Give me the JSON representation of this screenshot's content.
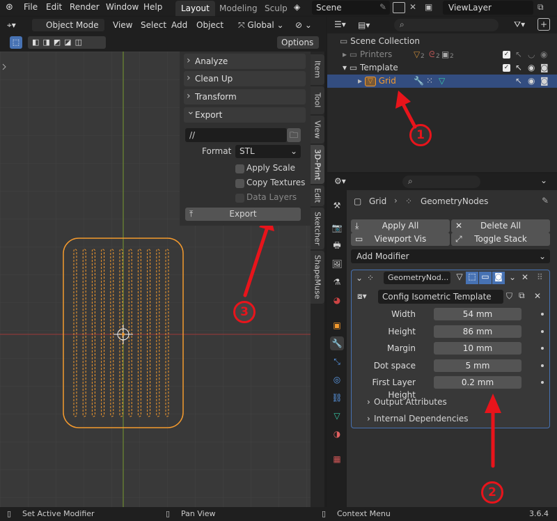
{
  "topbar": {
    "menu": [
      "File",
      "Edit",
      "Render",
      "Window",
      "Help"
    ],
    "workspaces": [
      "Layout",
      "Modeling",
      "Sculp"
    ],
    "scene": "Scene",
    "view_layer": "ViewLayer"
  },
  "viewport_header": {
    "mode": "Object Mode",
    "menus": [
      "View",
      "Select",
      "Add",
      "Object"
    ],
    "orientation": "Global",
    "options": "Options"
  },
  "npanel": {
    "sections": [
      "Analyze",
      "Clean Up",
      "Transform",
      "Export"
    ],
    "export_path": "//",
    "format_label": "Format",
    "format_value": "STL",
    "checkboxes": [
      "Apply Scale",
      "Copy Textures",
      "Data Layers"
    ],
    "export_button": "Export",
    "tabs": [
      "Item",
      "Tool",
      "View",
      "3D-Print",
      "Edit",
      "Sketcher",
      "ShapeMuse"
    ]
  },
  "outliner": {
    "root": "Scene Collection",
    "rows": [
      {
        "label": "Printers",
        "counts": [
          "2",
          "2",
          "2"
        ]
      },
      {
        "label": "Template"
      },
      {
        "label": "Grid"
      }
    ]
  },
  "properties": {
    "breadcrumb_object": "Grid",
    "breadcrumb_modifier": "GeometryNodes",
    "buttons": {
      "apply_all": "Apply All",
      "delete_all": "Delete All",
      "viewport_vis": "Viewport Vis",
      "toggle_stack": "Toggle Stack"
    },
    "add_modifier": "Add Modifier",
    "modifier_name": "GeometryNod...",
    "node_group": "Config Isometric Template",
    "fields": [
      {
        "label": "Width",
        "value": "54 mm"
      },
      {
        "label": "Height",
        "value": "86 mm"
      },
      {
        "label": "Margin",
        "value": "10 mm"
      },
      {
        "label": "Dot space",
        "value": "5 mm"
      },
      {
        "label": "First Layer Height",
        "value": "0.2 mm"
      }
    ],
    "subpanels": [
      "Output Attributes",
      "Internal Dependencies"
    ]
  },
  "statusbar": {
    "left": "Set Active Modifier",
    "middle": "Pan View",
    "right": "Context Menu",
    "version": "3.6.4"
  },
  "annotations": [
    "1",
    "2",
    "3"
  ],
  "colors": {
    "selection_orange": "#f49a2e",
    "annotation_red": "#e8141b",
    "active_blue": "#4772b3"
  }
}
